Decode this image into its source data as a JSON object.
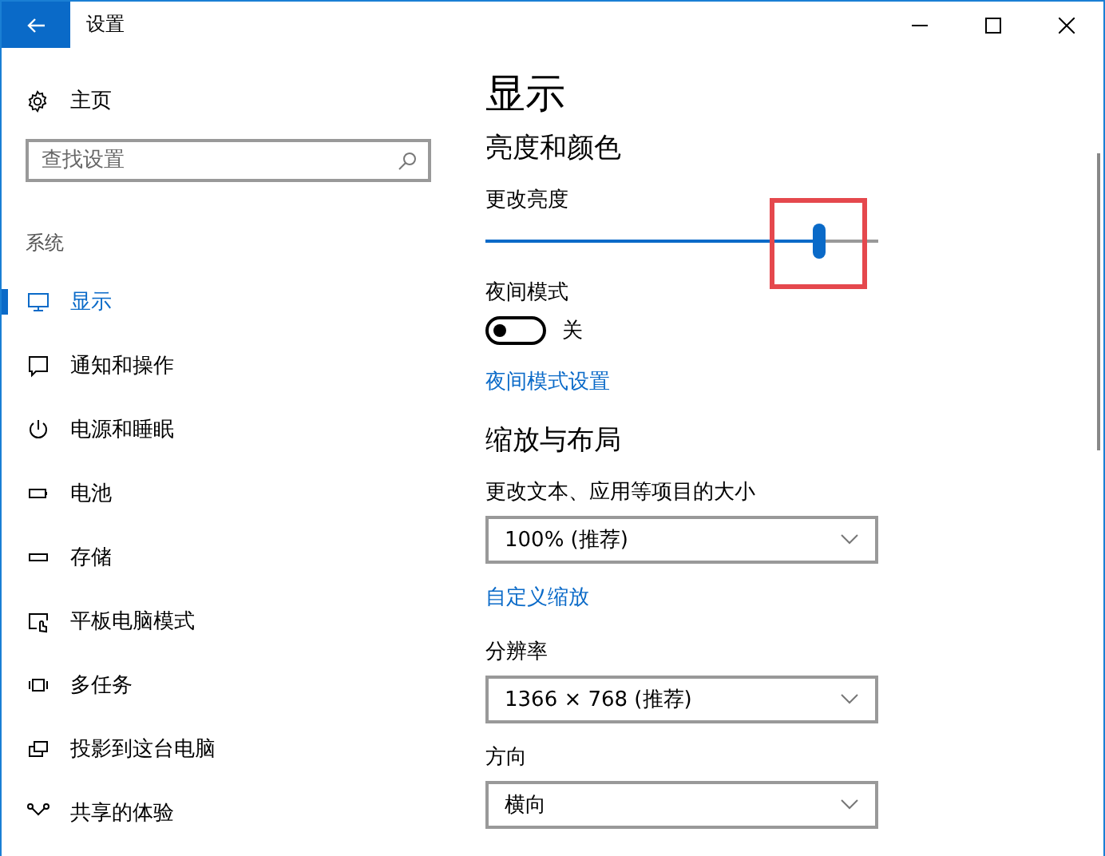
{
  "window": {
    "title": "设置"
  },
  "sidebar": {
    "home": "主页",
    "search": {
      "placeholder": "查找设置"
    },
    "section": "系统",
    "items": [
      {
        "label": "显示",
        "selected": true
      },
      {
        "label": "通知和操作",
        "selected": false
      },
      {
        "label": "电源和睡眠",
        "selected": false
      },
      {
        "label": "电池",
        "selected": false
      },
      {
        "label": "存储",
        "selected": false
      },
      {
        "label": "平板电脑模式",
        "selected": false
      },
      {
        "label": "多任务",
        "selected": false
      },
      {
        "label": "投影到这台电脑",
        "selected": false
      },
      {
        "label": "共享的体验",
        "selected": false
      }
    ]
  },
  "content": {
    "title": "显示",
    "sections": [
      {
        "heading": "亮度和颜色",
        "controls": [
          {
            "kind": "slider",
            "label": "更改亮度",
            "level": 0.85,
            "highlighted": true
          },
          {
            "kind": "toggle",
            "label": "夜间模式",
            "on": false,
            "state_text": "关"
          },
          {
            "kind": "link",
            "label": "夜间模式设置"
          }
        ]
      },
      {
        "heading": "缩放与布局",
        "controls": [
          {
            "kind": "dropdown",
            "label": "更改文本、应用等项目的大小",
            "value": "100% (推荐)"
          },
          {
            "kind": "link",
            "label": "自定义缩放"
          },
          {
            "kind": "dropdown",
            "label": "分辨率",
            "value": "1366 × 768 (推荐)"
          },
          {
            "kind": "dropdown",
            "label": "方向",
            "value": "横向"
          }
        ]
      }
    ]
  }
}
